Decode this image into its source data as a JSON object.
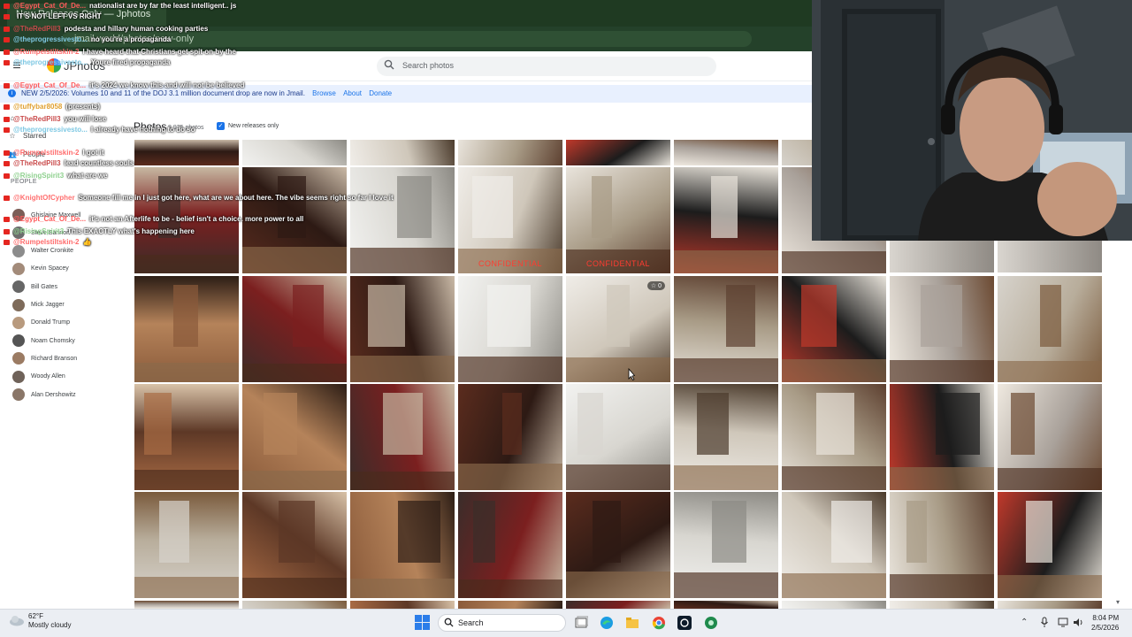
{
  "browser": {
    "tab_title": "New Releases Only — Jphotos",
    "url": "jmail.world/photos/new-only"
  },
  "app": {
    "title": "JPhotos",
    "search_placeholder": "Search photos"
  },
  "banner": {
    "text": "NEW 2/5/2026: Volumes 10 and 11 of the DOJ 3.1 million document drop are now in Jmail.",
    "links": [
      "Browse",
      "About",
      "Donate"
    ]
  },
  "sidebar": {
    "nav": [
      "Starred",
      "People"
    ],
    "people_header": "PEOPLE",
    "people": [
      "Ghislaine Maxwell",
      "Steve Bannon",
      "Walter Cronkite",
      "Kevin Spacey",
      "Bill Gates",
      "Mick Jagger",
      "Donald Trump",
      "Noam Chomsky",
      "Richard Branson",
      "Woody Allen",
      "Alan Dershowitz"
    ]
  },
  "main": {
    "heading": "Photos",
    "count": "8,925 photos",
    "filter_label": "New releases only",
    "overlays": {
      "confidential": "CONFIDENTIAL",
      "star_badge": "☆ 0"
    }
  },
  "chat": [
    {
      "user": "@Egypt_Cat_Of_De...",
      "text": "nationalist are by far the least intelligent.. js",
      "color": "#ff5a5a"
    },
    {
      "user": "",
      "text": "IT'S NOT LEFT VS RIGHT",
      "color": "#ff5a5a"
    },
    {
      "user": "@TheRedPill3",
      "text": "podesta and hillary human cooking parties",
      "color": "#c94b4b"
    },
    {
      "user": "@theprogressivesto...",
      "text": "no you're a propaganda",
      "color": "#7ec8e3"
    },
    {
      "user": "@Rumpelstiltskin-2",
      "text": "I have heard that Christians get spit on by the",
      "color": "#ff6b6b"
    },
    {
      "user": "@theprogressivesto...",
      "text": "Youre fired propaganda",
      "color": "#7ec8e3"
    },
    {
      "user": "@Egypt_Cat_Of_De...",
      "text": "it's 2024 we know this and will not be believed",
      "color": "#ff5a5a"
    },
    {
      "user": "@tuffybar8058",
      "text": "(presents)",
      "color": "#e0a030"
    },
    {
      "user": "@TheRedPill3",
      "text": "you will lose",
      "color": "#c94b4b"
    },
    {
      "user": "@theprogressivesto...",
      "text": "I already have nothing to do so",
      "color": "#7ec8e3"
    },
    {
      "user": "@Rumpelstiltskin-2",
      "text": "I got it",
      "color": "#ff6b6b"
    },
    {
      "user": "@TheRedPill3",
      "text": "lead countless souls",
      "color": "#c94b4b"
    },
    {
      "user": "@RisingSpirit3",
      "text": "what are we",
      "color": "#8fd18f"
    },
    {
      "user": "@KnightOfCypher",
      "text": "Someone fill me in I just got here, what are we about here. The vibe seems right so far I love it",
      "color": "#ff7070"
    },
    {
      "user": "@Egypt_Cat_Of_De...",
      "text": "it's not an Afterlife to be - belief isn't a choice. more power to all",
      "color": "#ff5a5a"
    },
    {
      "user": "@RisingSpirit3",
      "text": "This EXACTLY what's happening here",
      "color": "#8fd18f"
    },
    {
      "user": "@Rumpelstiltskin-2",
      "text": "👍",
      "color": "#ff6b6b"
    }
  ],
  "taskbar": {
    "temperature": "62°F",
    "weather": "Mostly cloudy",
    "search_label": "Search",
    "time": "8:04 PM",
    "date": "2/5/2026"
  },
  "colors": {
    "accent": "#1a73e8",
    "banner_bg": "#e8f0fe",
    "browser_frame": "#1f3a22"
  }
}
